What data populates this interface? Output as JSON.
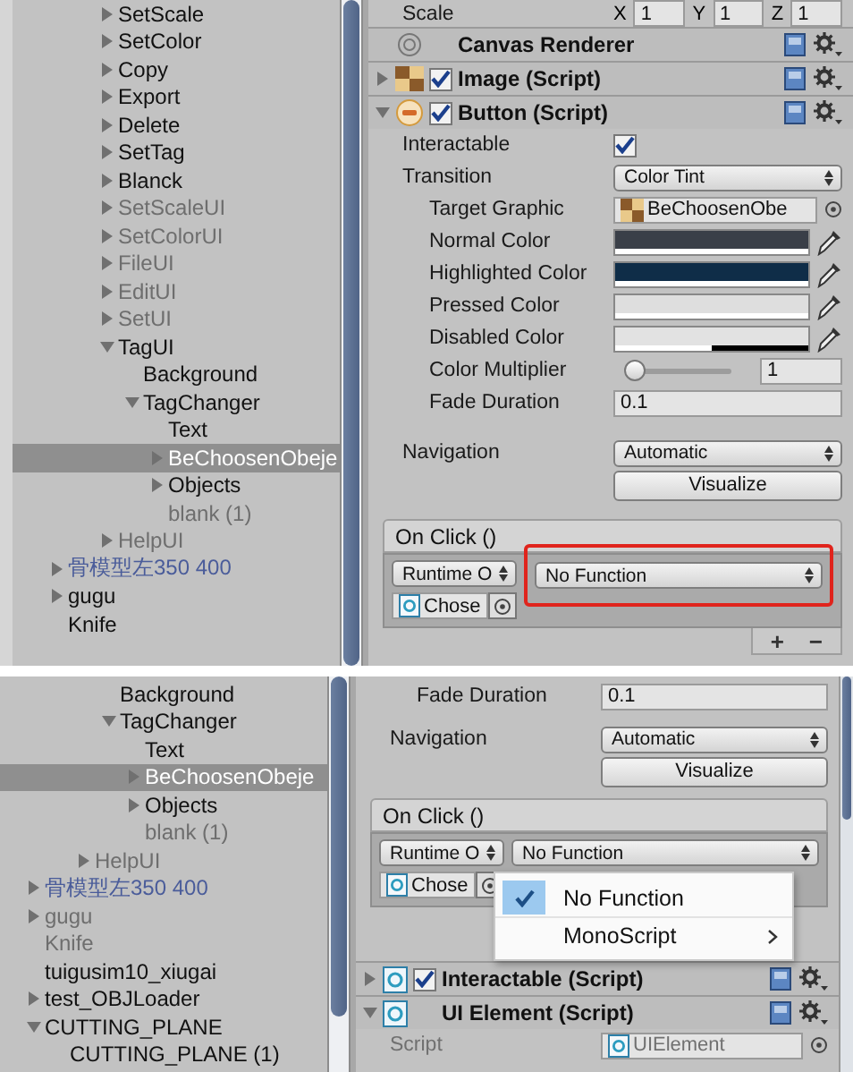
{
  "panels": [
    {
      "hierarchy": {
        "tree": [
          {
            "children": [
              {
                "children": [
                  {
                    "label": "SetScale",
                    "expanded": false,
                    "inactive": false,
                    "prefab": false,
                    "selected": false
                  },
                  {
                    "label": "SetColor",
                    "expanded": false,
                    "inactive": false,
                    "prefab": false,
                    "selected": false
                  },
                  {
                    "label": "Copy",
                    "expanded": false,
                    "inactive": false,
                    "prefab": false,
                    "selected": false
                  },
                  {
                    "label": "Export",
                    "expanded": false,
                    "inactive": false,
                    "prefab": false,
                    "selected": false
                  },
                  {
                    "label": "Delete",
                    "expanded": false,
                    "inactive": false,
                    "prefab": false,
                    "selected": false
                  },
                  {
                    "label": "SetTag",
                    "expanded": false,
                    "inactive": false,
                    "prefab": false,
                    "selected": false
                  },
                  {
                    "label": "Blanck",
                    "expanded": false,
                    "inactive": false,
                    "prefab": false,
                    "selected": false
                  },
                  {
                    "label": "SetScaleUI",
                    "expanded": false,
                    "inactive": true,
                    "prefab": false,
                    "selected": false
                  },
                  {
                    "label": "SetColorUI",
                    "expanded": false,
                    "inactive": true,
                    "prefab": false,
                    "selected": false
                  },
                  {
                    "label": "FileUI",
                    "expanded": false,
                    "inactive": true,
                    "prefab": false,
                    "selected": false
                  },
                  {
                    "label": "EditUI",
                    "expanded": false,
                    "inactive": true,
                    "prefab": false,
                    "selected": false
                  },
                  {
                    "label": "SetUI",
                    "expanded": false,
                    "inactive": true,
                    "prefab": false,
                    "selected": false
                  },
                  {
                    "label": "TagUI",
                    "expanded": true,
                    "inactive": false,
                    "prefab": false,
                    "selected": false,
                    "children": [
                      {
                        "label": "Background",
                        "inactive": false,
                        "prefab": false,
                        "selected": false
                      },
                      {
                        "label": "TagChanger",
                        "expanded": true,
                        "inactive": false,
                        "prefab": false,
                        "selected": false,
                        "children": [
                          {
                            "label": "Text",
                            "inactive": false,
                            "prefab": false,
                            "selected": false
                          },
                          {
                            "label": "BeChoosenObeje",
                            "expanded": false,
                            "inactive": false,
                            "prefab": false,
                            "selected": true
                          },
                          {
                            "label": "Objects",
                            "expanded": false,
                            "inactive": false,
                            "prefab": false,
                            "selected": false
                          },
                          {
                            "label": "blank (1)",
                            "inactive": true,
                            "prefab": false,
                            "selected": false
                          }
                        ]
                      }
                    ]
                  },
                  {
                    "label": "HelpUI",
                    "expanded": false,
                    "inactive": true,
                    "prefab": false,
                    "selected": false
                  }
                ]
              }
            ]
          },
          {
            "label": "骨模型左350 400",
            "expanded": false,
            "inactive": false,
            "prefab": true,
            "selected": false
          },
          {
            "label": "gugu",
            "expanded": false,
            "inactive": false,
            "prefab": false,
            "selected": false
          },
          {
            "label": "Knife",
            "inactive": false,
            "prefab": false,
            "selected": false
          }
        ]
      },
      "inspector": [
        {
          "kind": "vector3",
          "label": "Scale",
          "fields": [
            {
              "axis": "X",
              "value": "1"
            },
            {
              "axis": "Y",
              "value": "1"
            },
            {
              "axis": "Z",
              "value": "1"
            }
          ]
        },
        {
          "kind": "component",
          "title": "Canvas Renderer"
        },
        {
          "kind": "component",
          "title": "Image (Script)",
          "expanded": false,
          "enabled": true
        },
        {
          "kind": "component",
          "title": "Button (Script)",
          "expanded": true,
          "enabled": true
        },
        {
          "kind": "checkbox",
          "label": "Interactable",
          "checked": true
        },
        {
          "kind": "dropdown",
          "label": "Transition",
          "value": "Color Tint",
          "children": [
            {
              "kind": "object",
              "label": "Target Graphic",
              "value": "BeChoosenObe",
              "disabled": false
            },
            {
              "kind": "color",
              "label": "Normal Color",
              "color": "#3a3f48",
              "level": 1
            },
            {
              "kind": "color",
              "label": "Highlighted Color",
              "color": "#0f2d48",
              "level": 1
            },
            {
              "kind": "color",
              "label": "Pressed Color",
              "color": "#dedede",
              "level": 1
            },
            {
              "kind": "color",
              "label": "Disabled Color",
              "color": "#e2e2e2",
              "level": 0.5
            },
            {
              "kind": "slider",
              "label": "Color Multiplier",
              "level": 0,
              "value": "1"
            },
            {
              "kind": "number",
              "label": "Fade Duration",
              "value": "0.1"
            }
          ]
        },
        {
          "kind": "dropdown",
          "label": "Navigation",
          "value": "Automatic"
        },
        {
          "kind": "button",
          "label": "Visualize"
        },
        {
          "kind": "event",
          "title": "On Click ()",
          "entries": [
            {
              "runtime": "Runtime O",
              "function": "No Function",
              "object": "Chose",
              "highlighted": true
            }
          ],
          "add": "+",
          "remove": "−"
        }
      ]
    },
    {
      "hierarchy": {
        "tree": [
          {
            "children": [
              {
                "children": [
                  {
                    "children": [
                      {
                        "label": "Background",
                        "inactive": false,
                        "prefab": false,
                        "selected": false
                      },
                      {
                        "label": "TagChanger",
                        "expanded": true,
                        "inactive": false,
                        "prefab": false,
                        "selected": false,
                        "children": [
                          {
                            "label": "Text",
                            "inactive": false,
                            "prefab": false,
                            "selected": false
                          },
                          {
                            "label": "BeChoosenObeje",
                            "expanded": false,
                            "inactive": false,
                            "prefab": false,
                            "selected": true
                          },
                          {
                            "label": "Objects",
                            "expanded": false,
                            "inactive": false,
                            "prefab": false,
                            "selected": false
                          },
                          {
                            "label": "blank (1)",
                            "inactive": true,
                            "prefab": false,
                            "selected": false
                          }
                        ]
                      }
                    ]
                  },
                  {
                    "label": "HelpUI",
                    "expanded": false,
                    "inactive": true,
                    "prefab": false,
                    "selected": false
                  }
                ]
              }
            ]
          },
          {
            "label": "骨模型左350 400",
            "expanded": false,
            "inactive": false,
            "prefab": true,
            "selected": false
          },
          {
            "label": "gugu",
            "expanded": false,
            "inactive": true,
            "prefab": false,
            "selected": false
          },
          {
            "label": "Knife",
            "inactive": true,
            "prefab": false,
            "selected": false
          },
          {
            "label": "tuigusim10_xiugai",
            "inactive": false,
            "prefab": false,
            "selected": false
          },
          {
            "label": "test_OBJLoader",
            "expanded": false,
            "inactive": false,
            "prefab": false,
            "selected": false
          },
          {
            "label": "CUTTING_PLANE",
            "expanded": true,
            "inactive": false,
            "prefab": false,
            "selected": false,
            "children": [
              {
                "label": "CUTTING_PLANE (1)",
                "inactive": false,
                "prefab": false,
                "selected": false
              }
            ]
          }
        ]
      },
      "inspector": [
        {
          "kind": "group",
          "children": [
            {
              "kind": "number",
              "label": "Fade Duration",
              "value": "0.1"
            }
          ]
        },
        {
          "kind": "dropdown",
          "label": "Navigation",
          "value": "Automatic"
        },
        {
          "kind": "button",
          "label": "Visualize"
        },
        {
          "kind": "event",
          "title": "On Click ()",
          "entries": [
            {
              "runtime": "Runtime O",
              "function": "No Function",
              "object": "Chose",
              "menu": [
                {
                  "label": "No Function",
                  "selected": true,
                  "submenu": false
                },
                {
                  "label": "MonoScript",
                  "selected": false,
                  "submenu": true
                }
              ]
            }
          ]
        },
        {
          "kind": "component",
          "title": "Interactable (Script)",
          "expanded": false,
          "enabled": true
        },
        {
          "kind": "component",
          "title": "UI Element (Script)",
          "expanded": true
        },
        {
          "kind": "object",
          "label": "Script",
          "value": "UIElement",
          "disabled": true
        }
      ]
    }
  ]
}
